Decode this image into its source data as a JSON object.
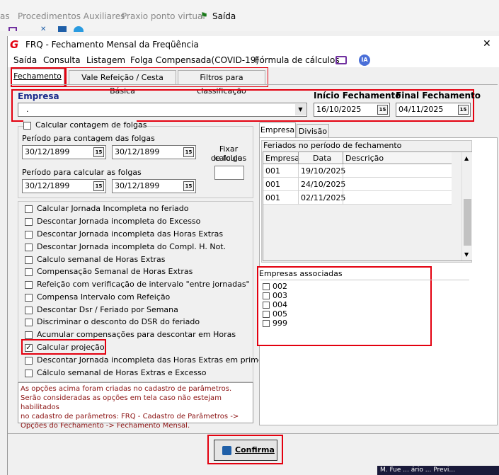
{
  "top_menu": {
    "items": [
      "as",
      "Procedimentos Auxiliares",
      "Praxio ponto virtual",
      "Saída"
    ]
  },
  "window": {
    "title": "FRQ - Fechamento Mensal da Freqüência",
    "close_glyph": "✕"
  },
  "menu": {
    "items": [
      "Saída",
      "Consulta",
      "Listagem",
      "Folga Compensada(COVID-19)",
      "Fórmula de cálculos"
    ],
    "ia_label": "IA"
  },
  "tabs": {
    "main": [
      "Fechamento",
      "Vale Refeição / Cesta Básica",
      "Filtros para classificação"
    ],
    "right": [
      "Empresa",
      "Divisão"
    ]
  },
  "empresa": {
    "label": "Empresa",
    "value": "."
  },
  "inicio": {
    "label": "Início Fechamento",
    "value": "16/10/2025"
  },
  "final": {
    "label": "Final Fechamento",
    "value": "04/11/2025"
  },
  "folgas": {
    "checkbox_label": "Calcular contagem de folgas",
    "periodo_contagem_label": "Período para contagem das folgas",
    "contagem_de": "30/12/1899",
    "contagem_ate": "30/12/1899",
    "periodo_calcular_label": "Período para calcular as folgas",
    "calcular_de": "30/12/1899",
    "calcular_ate": "30/12/1899",
    "fixar_label_1": "Fixar calculo",
    "fixar_label_2": "de folgas"
  },
  "options": [
    {
      "label": "Calcular Jornada Incompleta no feriado",
      "checked": false
    },
    {
      "label": "Descontar Jornada incompleta do Excesso",
      "checked": false
    },
    {
      "label": "Descontar Jornada incompleta das Horas Extras",
      "checked": false
    },
    {
      "label": "Descontar Jornada incompleta do Compl. H. Not.",
      "checked": false
    },
    {
      "label": "Calculo semanal de Horas Extras",
      "checked": false
    },
    {
      "label": "Compensação Semanal de Horas Extras",
      "checked": false
    },
    {
      "label": "Refeição com verificação de intervalo  \"entre jornadas\"",
      "checked": false
    },
    {
      "label": "Compensa Intervalo com Refeição",
      "checked": false
    },
    {
      "label": "Descontar Dsr / Feriado por Semana",
      "checked": false
    },
    {
      "label": "Discriminar o desconto do DSR do feriado",
      "checked": false
    },
    {
      "label": "Acumular compensações para descontar em Horas",
      "checked": false
    },
    {
      "label": "Calcular projeção",
      "checked": true
    },
    {
      "label": "Descontar Jornada incompleta das Horas Extras em primeiro",
      "checked": false
    },
    {
      "label": "Cálculo semanal de Horas Extras e Excesso",
      "checked": false
    }
  ],
  "notice": {
    "line1": "As opções acima foram criadas no cadastro de parâmetros.",
    "line2": "Serão consideradas as opções em tela caso não estejam habilitados",
    "line3": "no cadastro de parâmetros: FRQ - Cadastro de Parâmetros ->",
    "line4": "Opções do Fechamento -> Fechamento Mensal."
  },
  "feriados": {
    "label": "Feriados no período de fechamento",
    "headers": [
      "Empresa",
      "Data",
      "Descrição"
    ],
    "rows": [
      {
        "empresa": "001",
        "data": "19/10/2025",
        "descricao": ""
      },
      {
        "empresa": "001",
        "data": "24/10/2025",
        "descricao": ""
      },
      {
        "empresa": "001",
        "data": "02/11/2025",
        "descricao": ""
      }
    ]
  },
  "empresas_associadas": {
    "label": "Empresas associadas",
    "items": [
      "002",
      "003",
      "004",
      "005",
      "999"
    ]
  },
  "confirm_label": "Confirma",
  "taskbar_text": "M. Fue ... ário ... Previ..."
}
